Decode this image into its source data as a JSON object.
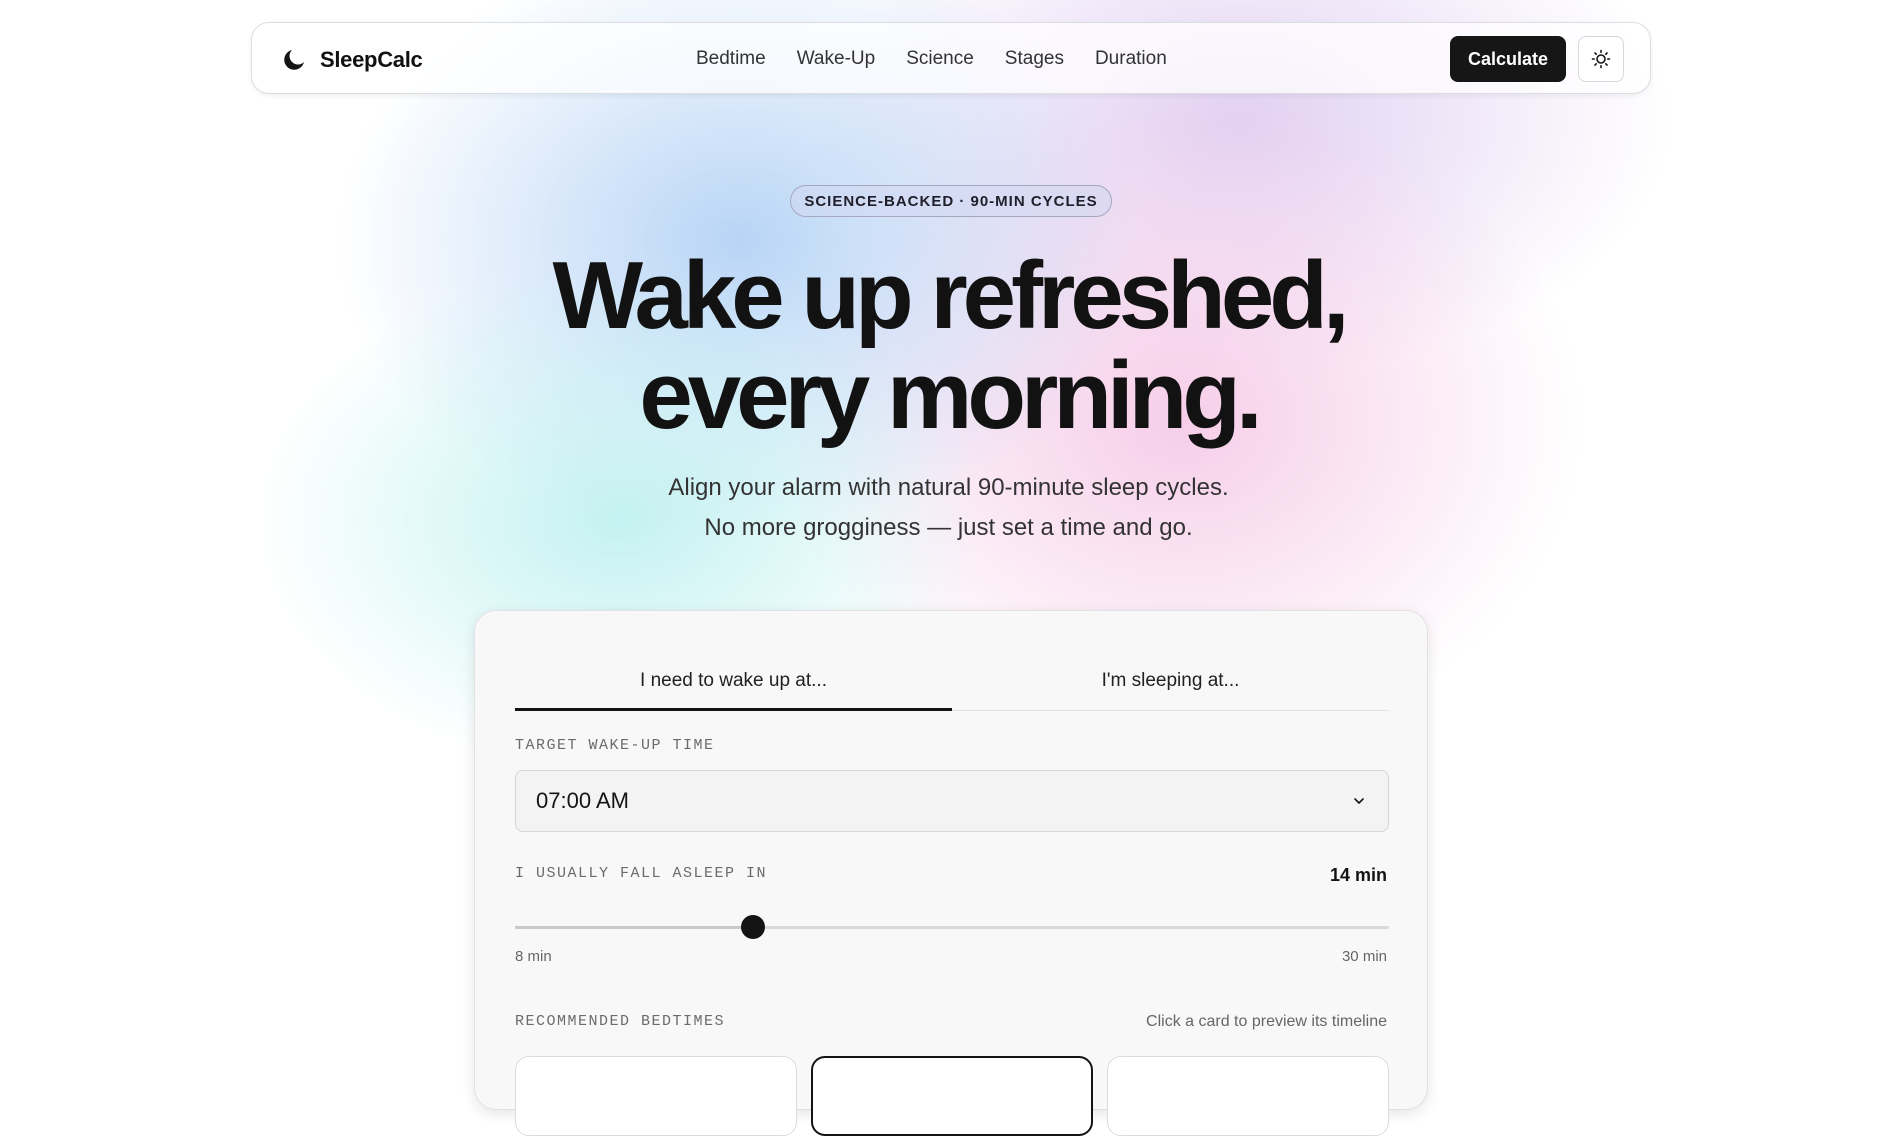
{
  "brand": {
    "name": "SleepCalc"
  },
  "nav": {
    "links": [
      "Bedtime",
      "Wake-Up",
      "Science",
      "Stages",
      "Duration"
    ],
    "cta_label": "Calculate"
  },
  "hero": {
    "badge": "SCIENCE-BACKED · 90-MIN CYCLES",
    "headline_line1": "Wake up refreshed,",
    "headline_line2": "every morning.",
    "sub_line1": "Align your alarm with natural 90-minute sleep cycles.",
    "sub_line2": "No more grogginess — just set a time and go."
  },
  "calculator": {
    "tabs": [
      "I need to wake up at...",
      "I'm sleeping at..."
    ],
    "active_tab": 0,
    "wake_label": "TARGET WAKE-UP TIME",
    "wake_value": "07:00 AM",
    "fall_asleep_label": "I USUALLY FALL ASLEEP IN",
    "fall_asleep_value": "14 min",
    "slider": {
      "min": 8,
      "max": 30,
      "value": 14,
      "min_label": "8 min",
      "max_label": "30 min"
    },
    "bedtimes_label": "RECOMMENDED BEDTIMES",
    "bedtimes_hint": "Click a card to preview its timeline",
    "selected_card": 1
  },
  "colors": {
    "accent": "#141414",
    "badge_bg": "#d2d7f0"
  },
  "icons": {
    "logo": "moon-icon",
    "theme": "sun-icon",
    "select": "chevron-down-icon"
  }
}
